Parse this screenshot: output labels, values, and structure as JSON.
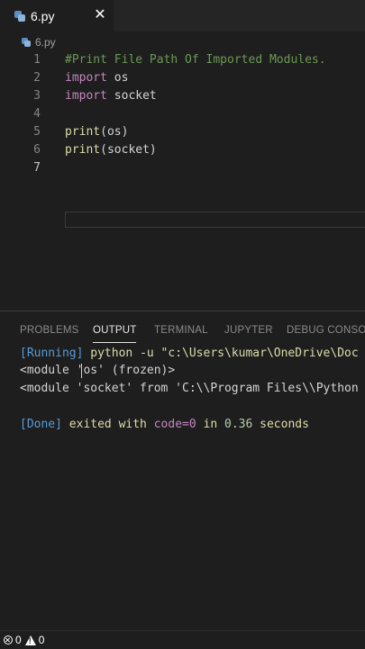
{
  "tab": {
    "label": "6.py",
    "close": "✕"
  },
  "breadcrumb": {
    "label": "6.py"
  },
  "editor": {
    "lines": [
      {
        "num": "1",
        "segs": [
          {
            "t": "#Print File Path Of Imported Modules.",
            "c": "c-comment"
          }
        ]
      },
      {
        "num": "2",
        "segs": [
          {
            "t": "import",
            "c": "c-kw"
          },
          {
            "t": " os",
            "c": "c-id"
          }
        ]
      },
      {
        "num": "3",
        "segs": [
          {
            "t": "import",
            "c": "c-kw"
          },
          {
            "t": " socket",
            "c": "c-id"
          }
        ]
      },
      {
        "num": "4",
        "segs": []
      },
      {
        "num": "5",
        "segs": [
          {
            "t": "print",
            "c": "c-fn"
          },
          {
            "t": "(os)",
            "c": "c-id"
          }
        ]
      },
      {
        "num": "6",
        "segs": [
          {
            "t": "print",
            "c": "c-fn"
          },
          {
            "t": "(socket)",
            "c": "c-id"
          }
        ]
      },
      {
        "num": "7",
        "segs": []
      }
    ]
  },
  "panel": {
    "tabs": [
      "PROBLEMS",
      "OUTPUT",
      "TERMINAL",
      "JUPYTER",
      "DEBUG CONSOLE"
    ],
    "active_tab": "OUTPUT"
  },
  "output": {
    "running_tag": "[Running]",
    "running_cmd": " python -u \"c:\\Users\\kumar\\OneDrive\\Doc",
    "line_os_a": "<module '",
    "line_os_b": "os' (frozen)>",
    "line_socket": "<module 'socket' from 'C:\\\\Program Files\\\\Python",
    "done_tag": "[Done]",
    "done_text": " exited with ",
    "done_code": "code=0",
    "done_in": " in ",
    "done_time": "0.36",
    "done_seconds": " seconds"
  },
  "status": {
    "errors": "0",
    "warnings": "0"
  }
}
